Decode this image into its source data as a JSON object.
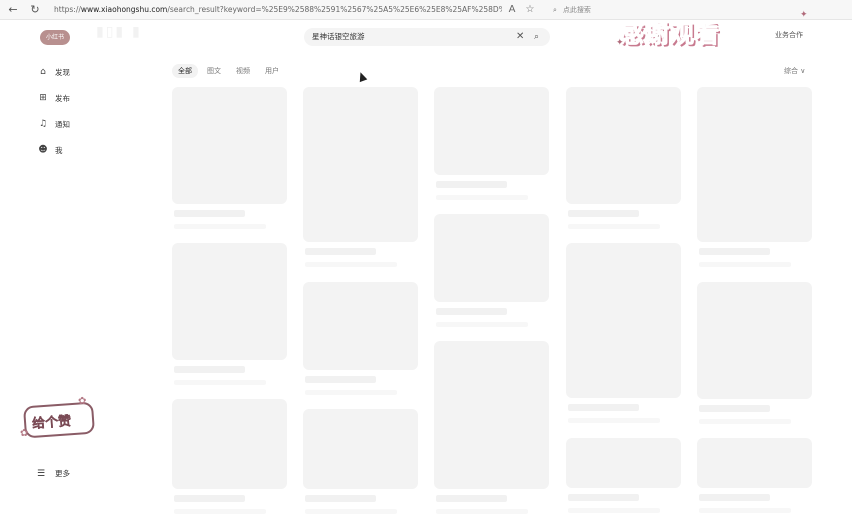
{
  "browser": {
    "url_prefix": "https://",
    "url_host": "www.xiaohongshu.com",
    "url_path": "/search_result?keyword=%25E9%2588%2591%2567%25A5%25E6%25E8%25AF%258D%2596%2582%259F%2...",
    "search_placeholder": "点此搜索",
    "icons": [
      "back-icon",
      "refresh-icon",
      "home-icon",
      "read-aloud-icon",
      "favorite-icon",
      "search-icon"
    ]
  },
  "header": {
    "logo_text": "小红书",
    "search_value": "星神话银空旅游",
    "right_text": "业务合作"
  },
  "overlay": {
    "thanks_text": "感谢观看",
    "sticker_text": "给个赞"
  },
  "sidebar": {
    "items": [
      {
        "label": "发现",
        "icon": "home-icon"
      },
      {
        "label": "发布",
        "icon": "publish-icon"
      },
      {
        "label": "通知",
        "icon": "bell-icon"
      },
      {
        "label": "我",
        "icon": "user-icon"
      }
    ],
    "more_label": "更多"
  },
  "tabs": [
    "全部",
    "图文",
    "视频",
    "用户"
  ],
  "sort_label": "综合 ∨"
}
